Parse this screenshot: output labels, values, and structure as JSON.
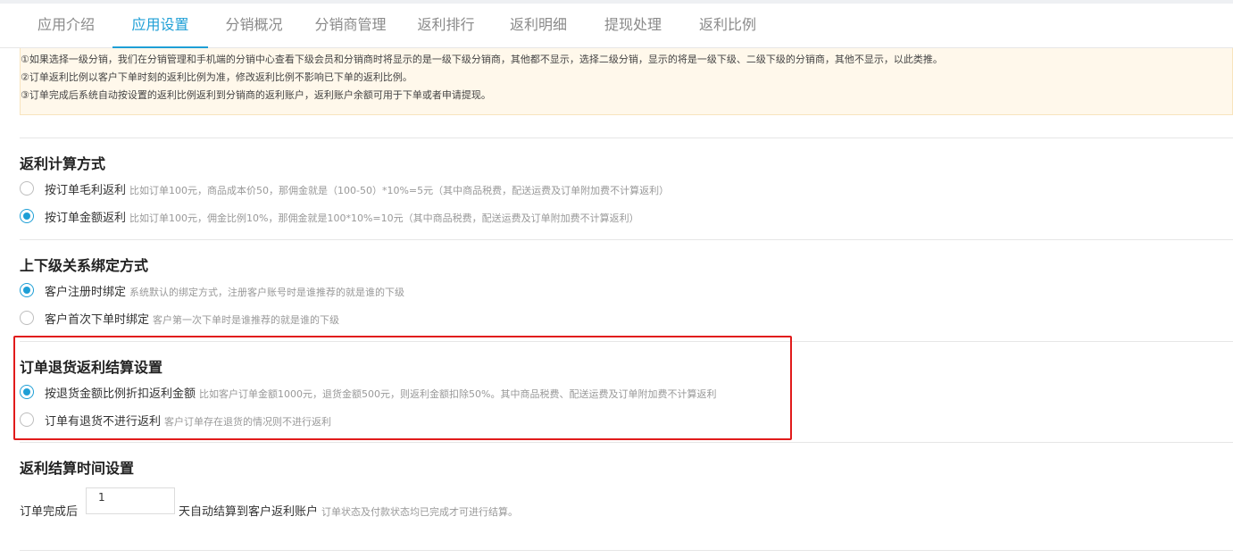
{
  "tabs": [
    {
      "label": "应用介绍",
      "active": false
    },
    {
      "label": "应用设置",
      "active": true
    },
    {
      "label": "分销概况",
      "active": false
    },
    {
      "label": "分销商管理",
      "active": false
    },
    {
      "label": "返利排行",
      "active": false
    },
    {
      "label": "返利明细",
      "active": false
    },
    {
      "label": "提现处理",
      "active": false
    },
    {
      "label": "返利比例",
      "active": false
    }
  ],
  "notice": {
    "lines": [
      "①如果选择一级分销，我们在分销管理和手机端的分销中心查看下级会员和分销商时将显示的是一级下级分销商，其他都不显示，选择二级分销，显示的将是一级下级、二级下级的分销商，其他不显示，以此类推。",
      "②订单返利比例以客户下单时刻的返利比例为准，修改返利比例不影响已下单的返利比例。",
      "③订单完成后系统自动按设置的返利比例返利到分销商的返利账户，返利账户余额可用于下单或者申请提现。"
    ]
  },
  "calc_method": {
    "title": "返利计算方式",
    "options": [
      {
        "label": "按订单毛利返利",
        "hint": "比如订单100元，商品成本价50，那佣金就是（100-50）*10%=5元（其中商品税费，配送运费及订单附加费不计算返利）",
        "checked": false
      },
      {
        "label": "按订单金额返利",
        "hint": "比如订单100元，佣金比例10%，那佣金就是100*10%=10元（其中商品税费，配送运费及订单附加费不计算返利）",
        "checked": true
      }
    ]
  },
  "binding_method": {
    "title": "上下级关系绑定方式",
    "options": [
      {
        "label": "客户注册时绑定",
        "hint": "系统默认的绑定方式，注册客户账号时是谁推荐的就是谁的下级",
        "checked": true
      },
      {
        "label": "客户首次下单时绑定",
        "hint": "客户第一次下单时是谁推荐的就是谁的下级",
        "checked": false
      }
    ]
  },
  "return_settlement": {
    "title": "订单退货返利结算设置",
    "options": [
      {
        "label": "按退货金额比例折扣返利金额",
        "hint": "比如客户订单金额1000元，退货金额500元，则返利金额扣除50%。其中商品税费、配送运费及订单附加费不计算返利",
        "checked": true
      },
      {
        "label": "订单有退货不进行返利",
        "hint": "客户订单存在退货的情况则不进行返利",
        "checked": false
      }
    ]
  },
  "settle_time": {
    "title": "返利结算时间设置",
    "prefix": "订单完成后",
    "days_value": "1",
    "suffix": "天自动结算到客户返利账户",
    "hint": "订单状态及付款状态均已完成才可进行结算。"
  },
  "colors": {
    "accent": "#1e9fd6",
    "highlight_border": "#e11b1b",
    "notice_bg": "#fff8eb"
  }
}
